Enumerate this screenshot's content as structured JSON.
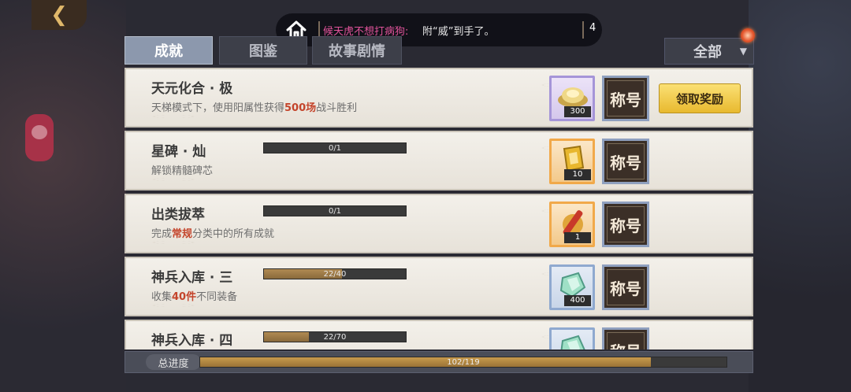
{
  "notice": {
    "sender": "候天虎不想打病狗:",
    "message": "附“威”到手了。",
    "count": "4"
  },
  "tabs": [
    {
      "label": "成就",
      "active": true
    },
    {
      "label": "图鉴",
      "active": false
    },
    {
      "label": "故事剧情",
      "active": false
    }
  ],
  "filter": {
    "label": "全部"
  },
  "achievements": [
    {
      "title": "天元化合 · 极",
      "desc_pre": "天梯模式下，使用阳属性获得",
      "desc_hl": "500场",
      "desc_post": "战斗胜利",
      "progress_text": "",
      "progress_fraction": null,
      "reward": {
        "icon": "gold-ingot-icon",
        "quantity": "300",
        "frame": "purple"
      },
      "title_badge": "称号",
      "action": "领取奖励"
    },
    {
      "title": "星碑 · 灿",
      "desc_pre": "解锁精髓碑芯",
      "desc_hl": "",
      "desc_post": "",
      "progress_text": "0/1",
      "progress_fraction": 0,
      "reward": {
        "icon": "gold-tablet-icon",
        "quantity": "10",
        "frame": "orange"
      },
      "title_badge": "称号"
    },
    {
      "title": "出类拔萃",
      "desc_pre": "完成",
      "desc_hl": "常规",
      "desc_post": "分类中的所有成就",
      "progress_text": "0/1",
      "progress_fraction": 0,
      "reward": {
        "icon": "red-scroll-icon",
        "quantity": "1",
        "frame": "orange"
      },
      "title_badge": "称号"
    },
    {
      "title": "神兵入库 · 三",
      "desc_pre": "收集",
      "desc_hl": "40件",
      "desc_post": "不同装备",
      "progress_text": "22/40",
      "progress_fraction": 0.55,
      "reward": {
        "icon": "jade-crystal-icon",
        "quantity": "400",
        "frame": "blue"
      },
      "title_badge": "称号"
    },
    {
      "title": "神兵入库 · 四",
      "desc_pre": "",
      "desc_hl": "",
      "desc_post": "",
      "progress_text": "22/70",
      "progress_fraction": 0.314,
      "reward": {
        "icon": "jade-crystal-icon",
        "quantity": "",
        "frame": "blue"
      },
      "title_badge": "称号"
    }
  ],
  "total": {
    "label": "总进度",
    "progress_text": "102/119",
    "progress_fraction": 0.857
  }
}
